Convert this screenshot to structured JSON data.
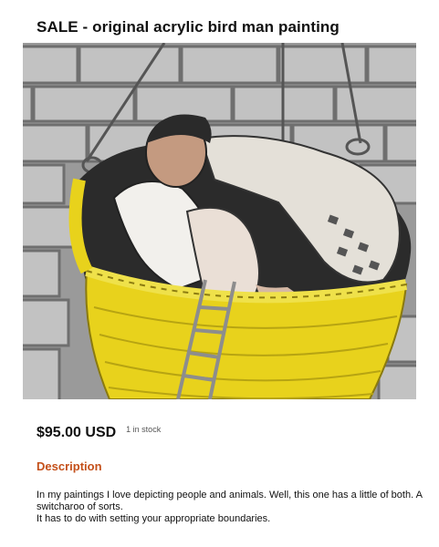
{
  "product": {
    "title": "SALE - original acrylic bird man painting",
    "image_alt": "Acrylic painting of a bird man and a pale figure in a yellow woven basket hanging by ropes against a grey brick wall",
    "price": "$95.00 USD",
    "stock": "1 in stock"
  },
  "description": {
    "heading": "Description",
    "paragraphs": [
      "In my paintings I love depicting people and animals. Well, this one has a little of both. A switcharoo of sorts.",
      "It has to do with setting your appropriate boundaries."
    ]
  },
  "colors": {
    "heading_accent": "#c4501a",
    "basket_yellow": "#e8d21c",
    "brick_grey": "#b9b9b9"
  }
}
